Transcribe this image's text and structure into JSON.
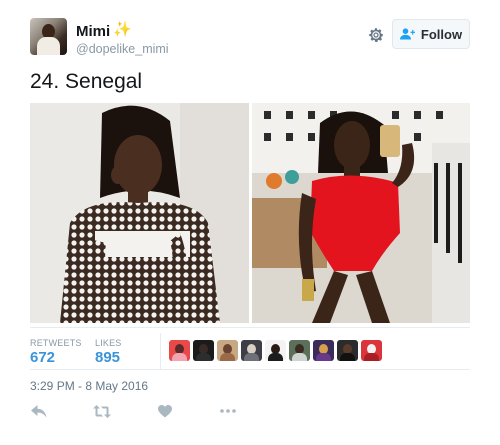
{
  "header": {
    "name": "Mimi",
    "name_emoji": "✨",
    "handle": "@dopelike_mimi",
    "follow_label": "Follow"
  },
  "tweet": {
    "text": "24. Senegal",
    "timestamp": "3:29 PM - 8 May 2016"
  },
  "stats": {
    "retweets_label": "RETWEETS",
    "retweets_value": "672",
    "likes_label": "LIKES",
    "likes_value": "895"
  },
  "liker_avatars_count": 9,
  "icons": {
    "settings": "gear-icon",
    "follow": "add-user-icon",
    "reply": "reply-icon",
    "retweet": "retweet-icon",
    "like": "heart-icon",
    "more": "more-icon"
  },
  "colors": {
    "accent": "#3b94d9",
    "meta_text": "#8899a6",
    "action_icon": "#aab8c2",
    "follow_icon": "#1da1f2"
  }
}
